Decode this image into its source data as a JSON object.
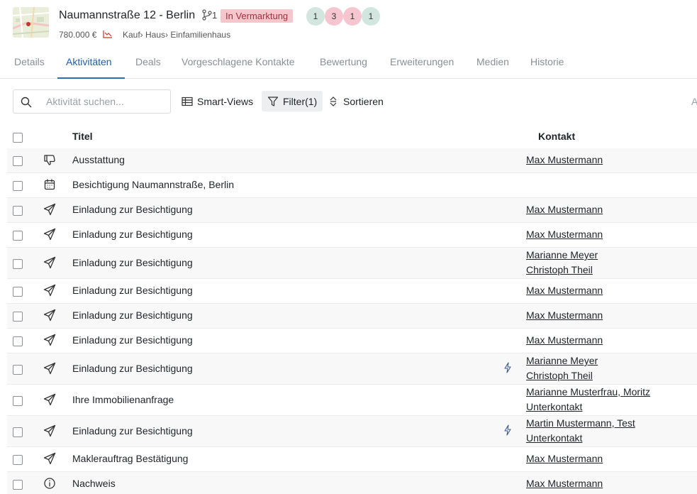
{
  "property": {
    "title": "Naumannstraße 12 - Berlin",
    "branch_count": "1",
    "status": "In Vermarktung",
    "counters": [
      {
        "value": "1",
        "color": "#d3e5df"
      },
      {
        "value": "3",
        "color": "#f5c6cf"
      },
      {
        "value": "1",
        "color": "#f5c6cf"
      },
      {
        "value": "1",
        "color": "#d3e5df"
      }
    ],
    "price": "780.000 €",
    "breadcrumb": "Kauf› Haus› Einfamilienhaus"
  },
  "tabs": [
    {
      "label": "Details",
      "active": false
    },
    {
      "label": "Aktivitäten",
      "active": true
    },
    {
      "label": "Deals",
      "active": false
    },
    {
      "label": "Vorgeschlagene Kontakte",
      "active": false
    },
    {
      "label": "Bewertung",
      "active": false
    },
    {
      "label": "Erweiterungen",
      "active": false
    },
    {
      "label": "Medien",
      "active": false
    },
    {
      "label": "Historie",
      "active": false
    }
  ],
  "toolbar": {
    "search_placeholder": "Aktivität suchen...",
    "smart_views": "Smart-Views",
    "filter": "Filter(1)",
    "sort": "Sortieren",
    "cut_label": "A"
  },
  "table": {
    "col_title": "Titel",
    "col_contact": "Kontakt",
    "rows": [
      {
        "icon": "thumbs-down-icon",
        "title": "Ausstattung",
        "contacts": [
          "Max Mustermann"
        ],
        "bolt": false
      },
      {
        "icon": "calendar-icon",
        "title": "Besichtigung Naumannstraße, Berlin",
        "contacts": [],
        "bolt": false
      },
      {
        "icon": "send-icon",
        "title": "Einladung zur Besichtigung",
        "contacts": [
          "Max Mustermann"
        ],
        "bolt": false
      },
      {
        "icon": "send-icon",
        "title": "Einladung zur Besichtigung",
        "contacts": [
          "Max Mustermann"
        ],
        "bolt": false
      },
      {
        "icon": "send-icon",
        "title": "Einladung zur Besichtigung",
        "contacts": [
          "Marianne Meyer",
          "Christoph Theil"
        ],
        "bolt": false
      },
      {
        "icon": "send-icon",
        "title": "Einladung zur Besichtigung",
        "contacts": [
          "Max Mustermann"
        ],
        "bolt": false
      },
      {
        "icon": "send-icon",
        "title": "Einladung zur Besichtigung",
        "contacts": [
          "Max Mustermann"
        ],
        "bolt": false
      },
      {
        "icon": "send-icon",
        "title": "Einladung zur Besichtigung",
        "contacts": [
          "Max Mustermann"
        ],
        "bolt": false
      },
      {
        "icon": "send-icon",
        "title": "Einladung zur Besichtigung",
        "contacts": [
          "Marianne Meyer",
          "Christoph Theil"
        ],
        "bolt": true
      },
      {
        "icon": "send-icon",
        "title": "Ihre Immobilienanfrage",
        "contacts": [
          "Marianne Musterfrau, Moritz",
          "Unterkontakt"
        ],
        "bolt": false
      },
      {
        "icon": "send-icon",
        "title": "Einladung zur Besichtigung",
        "contacts": [
          "Martin Mustermann, Test",
          "Unterkontakt"
        ],
        "bolt": true
      },
      {
        "icon": "send-icon",
        "title": "Maklerauftrag Bestätigung",
        "contacts": [
          "Max Mustermann"
        ],
        "bolt": false
      },
      {
        "icon": "info-icon",
        "title": "Nachweis",
        "contacts": [
          "Max Mustermann"
        ],
        "bolt": false
      }
    ]
  }
}
